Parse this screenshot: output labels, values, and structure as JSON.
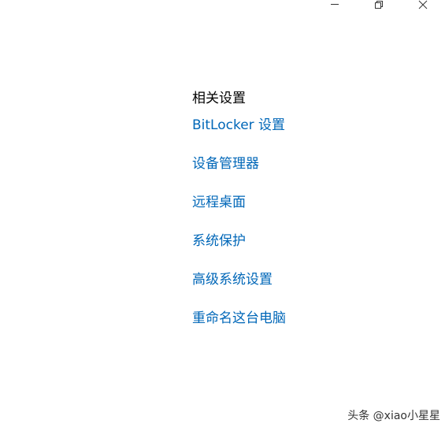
{
  "window_controls": {
    "minimize_icon": "minimize-icon",
    "restore_icon": "restore-icon",
    "close_icon": "close-icon"
  },
  "related_settings": {
    "heading": "相关设置",
    "links": [
      {
        "label": "BitLocker 设置"
      },
      {
        "label": "设备管理器"
      },
      {
        "label": "远程桌面"
      },
      {
        "label": "系统保护"
      },
      {
        "label": "高级系统设置"
      },
      {
        "label": "重命名这台电脑"
      }
    ]
  },
  "watermark": {
    "text": "头条 @xiao小星星"
  },
  "colors": {
    "link": "#0067b8",
    "heading": "#000000",
    "background": "#ffffff"
  }
}
